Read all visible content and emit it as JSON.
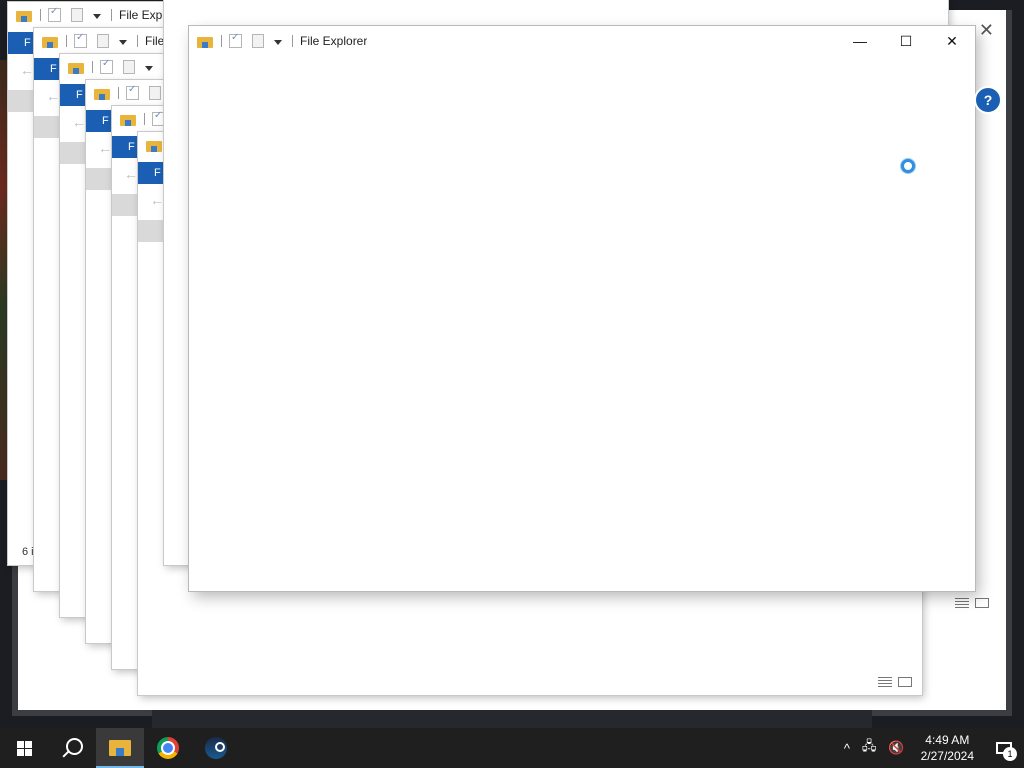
{
  "window": {
    "title": "File Explorer",
    "ghost_title": "File Expl",
    "ghost_title_short": "File",
    "ribbon_letter": "F",
    "status_partial": "6 i"
  },
  "window_controls": {
    "minimize": "—",
    "maximize": "☐",
    "close": "✕"
  },
  "taskbar": {
    "apps": [
      {
        "name": "Start",
        "icon": "windows-logo"
      },
      {
        "name": "Search",
        "icon": "search-icon"
      },
      {
        "name": "File Explorer",
        "icon": "folder-icon",
        "active": true
      },
      {
        "name": "Google Chrome",
        "icon": "chrome-icon"
      },
      {
        "name": "Steam",
        "icon": "steam-icon"
      }
    ],
    "tray": {
      "chevron": "^",
      "time": "4:49 AM",
      "date": "2/27/2024",
      "notification_count": "1"
    }
  },
  "colors": {
    "accent": "#1a5fb4",
    "taskbar": "#1f1f1f",
    "spinner": "#2f8fe0",
    "folder": "#e8b43b"
  }
}
